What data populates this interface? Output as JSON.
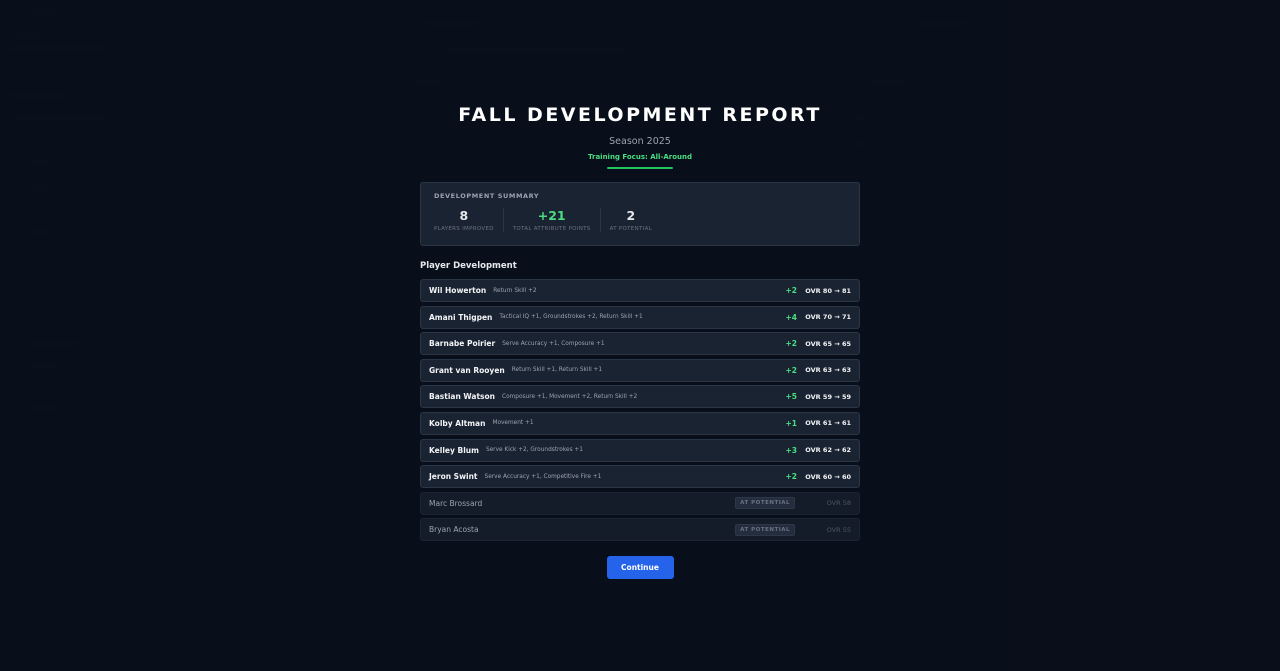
{
  "report": {
    "title": "FALL DEVELOPMENT REPORT",
    "season": "Season 2025",
    "training_focus": "Training Focus: All-Around"
  },
  "summary": {
    "title": "DEVELOPMENT SUMMARY",
    "stats": [
      {
        "value": "8",
        "label": "PLAYERS IMPROVED"
      },
      {
        "value": "+21",
        "label": "TOTAL ATTRIBUTE POINTS"
      },
      {
        "value": "2",
        "label": "AT POTENTIAL"
      }
    ]
  },
  "player_development": {
    "title": "Player Development",
    "players": [
      {
        "name": "Wil Howerton",
        "changes": "Return Skill +2",
        "delta": "+2",
        "ovr": "OVR 80 → 81"
      },
      {
        "name": "Amani Thigpen",
        "changes": "Tactical IQ +1, Groundstrokes +2, Return Skill +1",
        "delta": "+4",
        "ovr": "OVR 70 → 71"
      },
      {
        "name": "Barnabe Poirier",
        "changes": "Serve Accuracy +1, Composure +1",
        "delta": "+2",
        "ovr": "OVR 65 → 65"
      },
      {
        "name": "Grant van Rooyen",
        "changes": "Return Skill +1, Return Skill +1",
        "delta": "+2",
        "ovr": "OVR 63 → 63"
      },
      {
        "name": "Bastian Watson",
        "changes": "Composure +1, Movement +2, Return Skill +2",
        "delta": "+5",
        "ovr": "OVR 59 → 59"
      },
      {
        "name": "Kolby Altman",
        "changes": "Movement +1",
        "delta": "+1",
        "ovr": "OVR 61 → 61"
      },
      {
        "name": "Kelley Blum",
        "changes": "Serve Kick +2, Groundstrokes +1",
        "delta": "+3",
        "ovr": "OVR 62 → 62"
      },
      {
        "name": "Jeron Swint",
        "changes": "Serve Accuracy +1, Competitive Fire +1",
        "delta": "+2",
        "ovr": "OVR 60 → 60"
      }
    ],
    "at_potential": [
      {
        "name": "Marc Brossard",
        "badge": "AT POTENTIAL",
        "ovr": "OVR 58"
      },
      {
        "name": "Bryan Acosta",
        "badge": "AT POTENTIAL",
        "ovr": "OVR 55"
      }
    ]
  },
  "actions": {
    "continue_label": "Continue"
  },
  "colors": {
    "accent_green": "#4ade80",
    "primary_blue": "#2563eb",
    "background": "#0b1220",
    "card": "#1a2332"
  }
}
